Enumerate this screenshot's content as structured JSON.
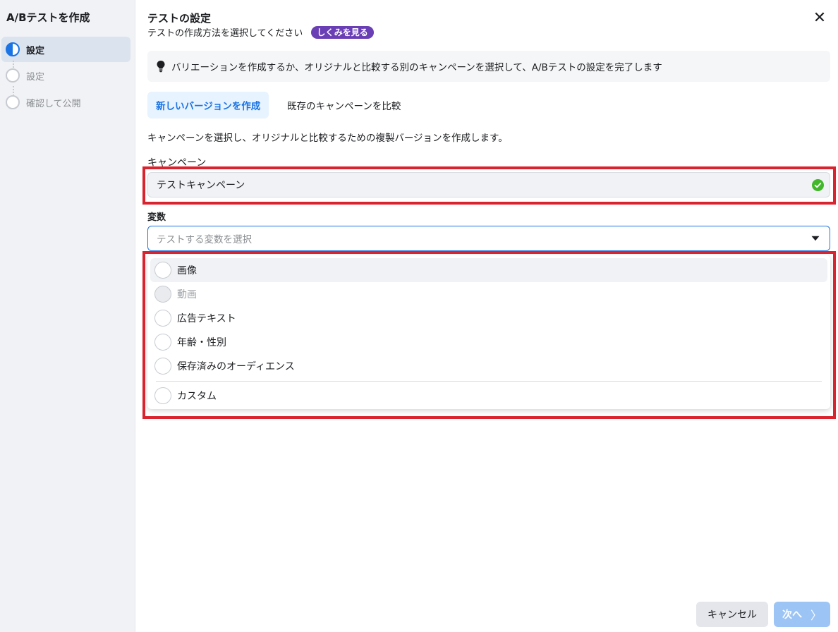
{
  "sidebar": {
    "title": "A/Bテストを作成",
    "steps": [
      {
        "label": "設定",
        "state": "active"
      },
      {
        "label": "設定",
        "state": "pending"
      },
      {
        "label": "確認して公開",
        "state": "pending"
      }
    ]
  },
  "header": {
    "title": "テストの設定",
    "subtitle": "テストの作成方法を選択してください",
    "badge": "しくみを見る",
    "close_symbol": "✕"
  },
  "info": {
    "text": "バリエーションを作成するか、オリジナルと比較する別のキャンペーンを選択して、A/Bテストの設定を完了します"
  },
  "tabs": [
    {
      "label": "新しいバージョンを作成",
      "active": true
    },
    {
      "label": "既存のキャンペーンを比較",
      "active": false
    }
  ],
  "description": "キャンペーンを選択し、オリジナルと比較するための複製バージョンを作成します。",
  "campaign": {
    "label": "キャンペーン",
    "value": "テストキャンペーン"
  },
  "variable": {
    "label": "変数",
    "placeholder": "テストする変数を選択",
    "options": [
      {
        "label": "画像",
        "disabled": false
      },
      {
        "label": "動画",
        "disabled": true
      },
      {
        "label": "広告テキスト",
        "disabled": false
      },
      {
        "label": "年齢・性別",
        "disabled": false
      },
      {
        "label": "保存済みのオーディエンス",
        "disabled": false
      },
      {
        "label": "カスタム",
        "disabled": false
      }
    ]
  },
  "footer": {
    "cancel": "キャンセル",
    "next": "次へ",
    "next_chevron": "〉"
  },
  "colors": {
    "accent": "#1b74e4",
    "badge": "#6a3fb5",
    "highlight": "#d9232e",
    "success": "#42b72a"
  }
}
